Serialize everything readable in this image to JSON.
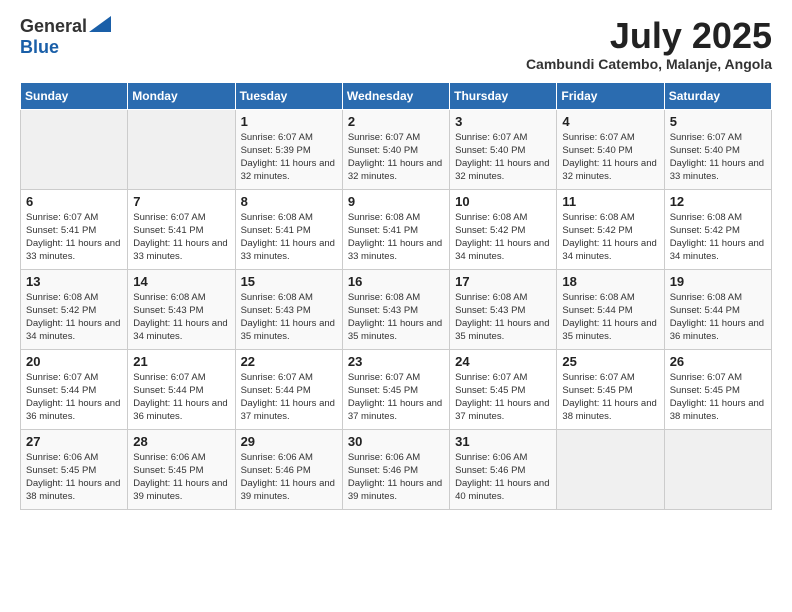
{
  "header": {
    "logo_general": "General",
    "logo_blue": "Blue",
    "month_title": "July 2025",
    "location": "Cambundi Catembo, Malanje, Angola"
  },
  "days_of_week": [
    "Sunday",
    "Monday",
    "Tuesday",
    "Wednesday",
    "Thursday",
    "Friday",
    "Saturday"
  ],
  "weeks": [
    [
      {
        "day": "",
        "info": ""
      },
      {
        "day": "",
        "info": ""
      },
      {
        "day": "1",
        "info": "Sunrise: 6:07 AM\nSunset: 5:39 PM\nDaylight: 11 hours and 32 minutes."
      },
      {
        "day": "2",
        "info": "Sunrise: 6:07 AM\nSunset: 5:40 PM\nDaylight: 11 hours and 32 minutes."
      },
      {
        "day": "3",
        "info": "Sunrise: 6:07 AM\nSunset: 5:40 PM\nDaylight: 11 hours and 32 minutes."
      },
      {
        "day": "4",
        "info": "Sunrise: 6:07 AM\nSunset: 5:40 PM\nDaylight: 11 hours and 32 minutes."
      },
      {
        "day": "5",
        "info": "Sunrise: 6:07 AM\nSunset: 5:40 PM\nDaylight: 11 hours and 33 minutes."
      }
    ],
    [
      {
        "day": "6",
        "info": "Sunrise: 6:07 AM\nSunset: 5:41 PM\nDaylight: 11 hours and 33 minutes."
      },
      {
        "day": "7",
        "info": "Sunrise: 6:07 AM\nSunset: 5:41 PM\nDaylight: 11 hours and 33 minutes."
      },
      {
        "day": "8",
        "info": "Sunrise: 6:08 AM\nSunset: 5:41 PM\nDaylight: 11 hours and 33 minutes."
      },
      {
        "day": "9",
        "info": "Sunrise: 6:08 AM\nSunset: 5:41 PM\nDaylight: 11 hours and 33 minutes."
      },
      {
        "day": "10",
        "info": "Sunrise: 6:08 AM\nSunset: 5:42 PM\nDaylight: 11 hours and 34 minutes."
      },
      {
        "day": "11",
        "info": "Sunrise: 6:08 AM\nSunset: 5:42 PM\nDaylight: 11 hours and 34 minutes."
      },
      {
        "day": "12",
        "info": "Sunrise: 6:08 AM\nSunset: 5:42 PM\nDaylight: 11 hours and 34 minutes."
      }
    ],
    [
      {
        "day": "13",
        "info": "Sunrise: 6:08 AM\nSunset: 5:42 PM\nDaylight: 11 hours and 34 minutes."
      },
      {
        "day": "14",
        "info": "Sunrise: 6:08 AM\nSunset: 5:43 PM\nDaylight: 11 hours and 34 minutes."
      },
      {
        "day": "15",
        "info": "Sunrise: 6:08 AM\nSunset: 5:43 PM\nDaylight: 11 hours and 35 minutes."
      },
      {
        "day": "16",
        "info": "Sunrise: 6:08 AM\nSunset: 5:43 PM\nDaylight: 11 hours and 35 minutes."
      },
      {
        "day": "17",
        "info": "Sunrise: 6:08 AM\nSunset: 5:43 PM\nDaylight: 11 hours and 35 minutes."
      },
      {
        "day": "18",
        "info": "Sunrise: 6:08 AM\nSunset: 5:44 PM\nDaylight: 11 hours and 35 minutes."
      },
      {
        "day": "19",
        "info": "Sunrise: 6:08 AM\nSunset: 5:44 PM\nDaylight: 11 hours and 36 minutes."
      }
    ],
    [
      {
        "day": "20",
        "info": "Sunrise: 6:07 AM\nSunset: 5:44 PM\nDaylight: 11 hours and 36 minutes."
      },
      {
        "day": "21",
        "info": "Sunrise: 6:07 AM\nSunset: 5:44 PM\nDaylight: 11 hours and 36 minutes."
      },
      {
        "day": "22",
        "info": "Sunrise: 6:07 AM\nSunset: 5:44 PM\nDaylight: 11 hours and 37 minutes."
      },
      {
        "day": "23",
        "info": "Sunrise: 6:07 AM\nSunset: 5:45 PM\nDaylight: 11 hours and 37 minutes."
      },
      {
        "day": "24",
        "info": "Sunrise: 6:07 AM\nSunset: 5:45 PM\nDaylight: 11 hours and 37 minutes."
      },
      {
        "day": "25",
        "info": "Sunrise: 6:07 AM\nSunset: 5:45 PM\nDaylight: 11 hours and 38 minutes."
      },
      {
        "day": "26",
        "info": "Sunrise: 6:07 AM\nSunset: 5:45 PM\nDaylight: 11 hours and 38 minutes."
      }
    ],
    [
      {
        "day": "27",
        "info": "Sunrise: 6:06 AM\nSunset: 5:45 PM\nDaylight: 11 hours and 38 minutes."
      },
      {
        "day": "28",
        "info": "Sunrise: 6:06 AM\nSunset: 5:45 PM\nDaylight: 11 hours and 39 minutes."
      },
      {
        "day": "29",
        "info": "Sunrise: 6:06 AM\nSunset: 5:46 PM\nDaylight: 11 hours and 39 minutes."
      },
      {
        "day": "30",
        "info": "Sunrise: 6:06 AM\nSunset: 5:46 PM\nDaylight: 11 hours and 39 minutes."
      },
      {
        "day": "31",
        "info": "Sunrise: 6:06 AM\nSunset: 5:46 PM\nDaylight: 11 hours and 40 minutes."
      },
      {
        "day": "",
        "info": ""
      },
      {
        "day": "",
        "info": ""
      }
    ]
  ]
}
